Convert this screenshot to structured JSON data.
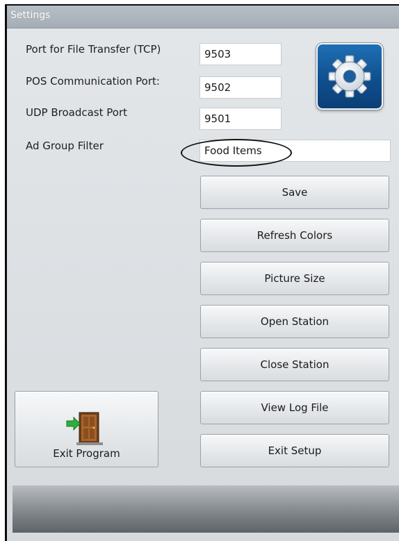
{
  "window": {
    "title": "Settings"
  },
  "fields": {
    "tcp_port": {
      "label": "Port for File Transfer (TCP)",
      "value": "9503"
    },
    "pos_port": {
      "label": "POS Communication Port:",
      "value": "9502"
    },
    "udp_port": {
      "label": "UDP Broadcast Port",
      "value": "9501"
    },
    "ad_group": {
      "label": "Ad Group Filter",
      "value": "Food Items"
    }
  },
  "buttons": {
    "save": "Save",
    "refresh_colors": "Refresh Colors",
    "picture_size": "Picture Size",
    "open_station": "Open Station",
    "close_station": "Close Station",
    "view_log": "View Log File",
    "exit_setup": "Exit Setup",
    "exit_program": "Exit Program"
  },
  "icons": {
    "settings_tile": "gear-icon",
    "exit_program": "door-exit-icon"
  },
  "colors": {
    "gear_tile": "#1565a8",
    "annotation_oval": "#111111"
  }
}
